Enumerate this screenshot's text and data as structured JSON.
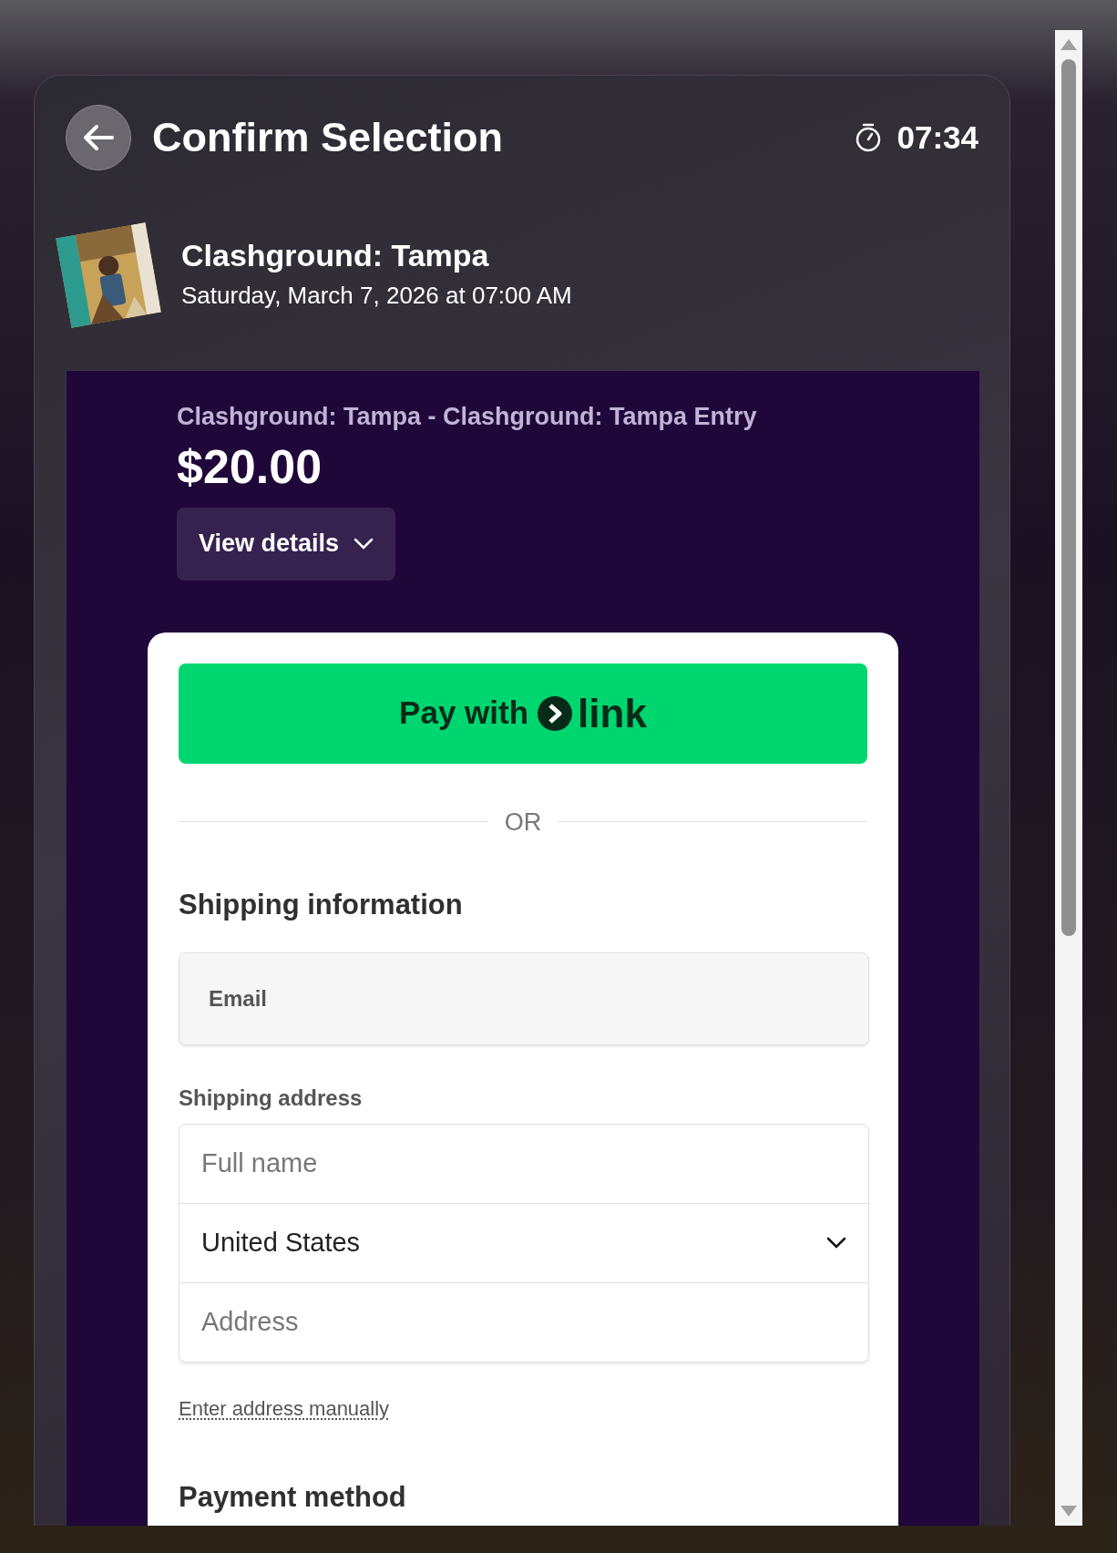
{
  "header": {
    "title": "Confirm Selection",
    "timer": "07:34"
  },
  "event": {
    "title": "Clashground: Tampa",
    "date": "Saturday, March 7, 2026 at 07:00 AM"
  },
  "order": {
    "product": "Clashground: Tampa - Clashground: Tampa Entry",
    "price": "$20.00",
    "details_button": "View details"
  },
  "checkout": {
    "link_button": {
      "prefix": "Pay with",
      "brand": "link"
    },
    "divider": "OR",
    "shipping_heading": "Shipping information",
    "email": {
      "placeholder": "Email"
    },
    "address_label": "Shipping address",
    "address_fields": [
      {
        "kind": "text",
        "placeholder": "Full name"
      },
      {
        "kind": "select",
        "value": "United States"
      },
      {
        "kind": "text",
        "placeholder": "Address"
      }
    ],
    "manual_link": "Enter address manually",
    "payment_heading": "Payment method"
  }
}
